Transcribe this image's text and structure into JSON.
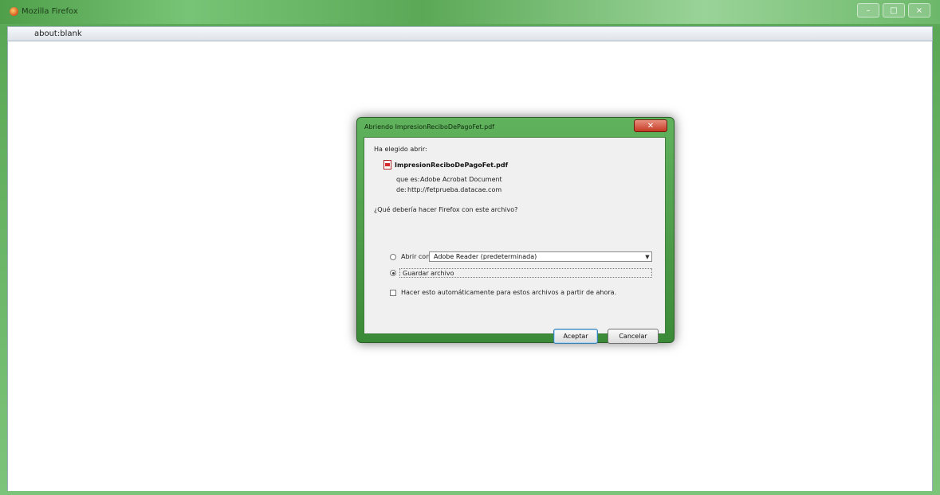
{
  "window": {
    "title": "Mozilla Firefox",
    "controls": {
      "minimize": "–",
      "maximize": "□",
      "close": "×"
    }
  },
  "tab": {
    "label": "about:blank"
  },
  "dialog": {
    "title": "Abriendo ImpresionReciboDePagoFet.pdf",
    "close_label": "✕",
    "intro": "Ha elegido abrir:",
    "file_name": "ImpresionReciboDePagoFet.pdf",
    "type_label": "que es:",
    "type_value": "Adobe Acrobat Document",
    "from_label": "de:",
    "from_value": "http://fetprueba.datacae.com",
    "question": "¿Qué debería hacer Firefox con este archivo?",
    "open_with_label": "Abrir con",
    "open_with_value": "Adobe Reader (predeterminada)",
    "save_label": "Guardar archivo",
    "auto_label": "Hacer esto automáticamente para estos archivos a partir de ahora.",
    "accept_label": "Aceptar",
    "cancel_label": "Cancelar",
    "selected_option": "save",
    "auto_checked": false
  },
  "icons": {
    "app": "firefox-icon",
    "file": "pdf-file-icon",
    "dropdown": "chevron-down-icon"
  },
  "colors": {
    "window_chrome": "#6fb86c",
    "dialog_frame": "#4a9c46",
    "close_button": "#c43a23"
  }
}
